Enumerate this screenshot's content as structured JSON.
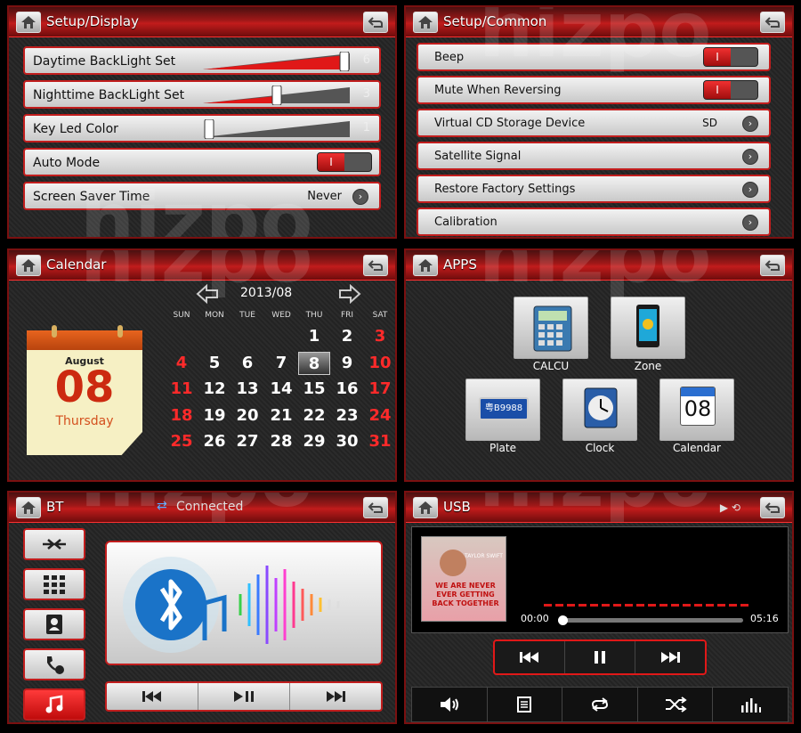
{
  "watermark": "hizpo",
  "display": {
    "title": "Setup/Display",
    "rows": [
      {
        "label": "Daytime BackLight Set",
        "value": "6"
      },
      {
        "label": "Nighttime BackLight Set",
        "value": "3"
      },
      {
        "label": "Key Led Color",
        "value": "1"
      },
      {
        "label": "Auto Mode"
      },
      {
        "label": "Screen Saver Time",
        "value": "Never"
      }
    ],
    "toggle_on": "I"
  },
  "common": {
    "title": "Setup/Common",
    "rows": [
      {
        "label": "Beep"
      },
      {
        "label": "Mute When Reversing"
      },
      {
        "label": "Virtual CD Storage Device",
        "value": "SD"
      },
      {
        "label": "Satellite Signal"
      },
      {
        "label": "Restore Factory Settings"
      },
      {
        "label": "Calibration"
      }
    ],
    "toggle_on": "I"
  },
  "calendar": {
    "title": "Calendar",
    "month": "2013/08",
    "page_month": "August",
    "page_day": "08",
    "page_weekday": "Thursday",
    "weekdays": [
      "SUN",
      "MON",
      "TUE",
      "WED",
      "THU",
      "FRI",
      "SAT"
    ],
    "days": [
      "1",
      "2",
      "3",
      "4",
      "5",
      "6",
      "7",
      "8",
      "9",
      "10",
      "11",
      "12",
      "13",
      "14",
      "15",
      "16",
      "17",
      "18",
      "19",
      "20",
      "21",
      "22",
      "23",
      "24",
      "25",
      "26",
      "27",
      "28",
      "29",
      "30",
      "31"
    ],
    "selected": "8"
  },
  "apps": {
    "title": "APPS",
    "items": [
      {
        "label": "CALCU"
      },
      {
        "label": "Zone"
      },
      {
        "label": "Plate",
        "plate_text": "粤B9988"
      },
      {
        "label": "Clock"
      },
      {
        "label": "Calendar",
        "icon_text": "08"
      }
    ]
  },
  "bt": {
    "title": "BT",
    "status": "Connected"
  },
  "usb": {
    "title": "USB",
    "elapsed": "00:00",
    "total": "05:16",
    "progress": 0,
    "album_artist": "TAYLOR SWIFT",
    "album_text": "WE ARE NEVER EVER GETTING BACK TOGETHER"
  }
}
